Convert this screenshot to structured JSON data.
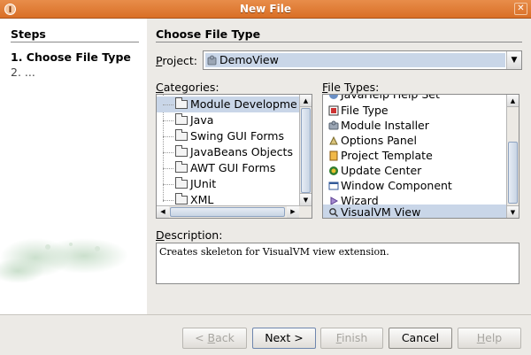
{
  "window": {
    "title": "New File"
  },
  "steps": {
    "header": "Steps",
    "items": [
      {
        "label": "1.  Choose File Type"
      },
      {
        "label": "2.  ..."
      }
    ]
  },
  "main": {
    "title": "Choose File Type",
    "project": {
      "label_mnemonic": "P",
      "label_rest": "roject:",
      "value": "DemoView"
    },
    "categories": {
      "label_mnemonic": "C",
      "label_rest": "ategories:",
      "items": [
        "Module Developme",
        "Java",
        "Swing GUI Forms",
        "JavaBeans Objects",
        "AWT GUI Forms",
        "JUnit",
        "XML"
      ],
      "selected_index": 0
    },
    "file_types": {
      "label_mnemonic": "F",
      "label_rest": "ile Types:",
      "items": [
        {
          "label": "JavaHelp Help Set",
          "icon": "help-set-icon"
        },
        {
          "label": "File Type",
          "icon": "file-type-icon"
        },
        {
          "label": "Module Installer",
          "icon": "module-installer-icon"
        },
        {
          "label": "Options Panel",
          "icon": "options-panel-icon"
        },
        {
          "label": "Project Template",
          "icon": "project-template-icon"
        },
        {
          "label": "Update Center",
          "icon": "update-center-icon"
        },
        {
          "label": "Window Component",
          "icon": "window-component-icon"
        },
        {
          "label": "Wizard",
          "icon": "wizard-icon"
        },
        {
          "label": "VisualVM View",
          "icon": "search-icon"
        }
      ],
      "selected_index": 8
    },
    "description": {
      "label_mnemonic": "D",
      "label_rest": "escription:",
      "text": "Creates skeleton for VisualVM view extension."
    }
  },
  "buttons": {
    "back": {
      "mnemonic": "B",
      "prefix": "< ",
      "rest": "ack",
      "enabled": false
    },
    "next": {
      "label": "Next >",
      "enabled": true
    },
    "finish": {
      "mnemonic": "F",
      "rest": "inish",
      "enabled": false
    },
    "cancel": {
      "label": "Cancel",
      "enabled": true
    },
    "help": {
      "mnemonic": "H",
      "rest": "elp",
      "enabled": false
    }
  },
  "colors": {
    "titlebar": "#d96f26",
    "selection": "#c9d6e8",
    "steps_bg": "#ffffff",
    "dialog_bg": "#eceae6"
  }
}
